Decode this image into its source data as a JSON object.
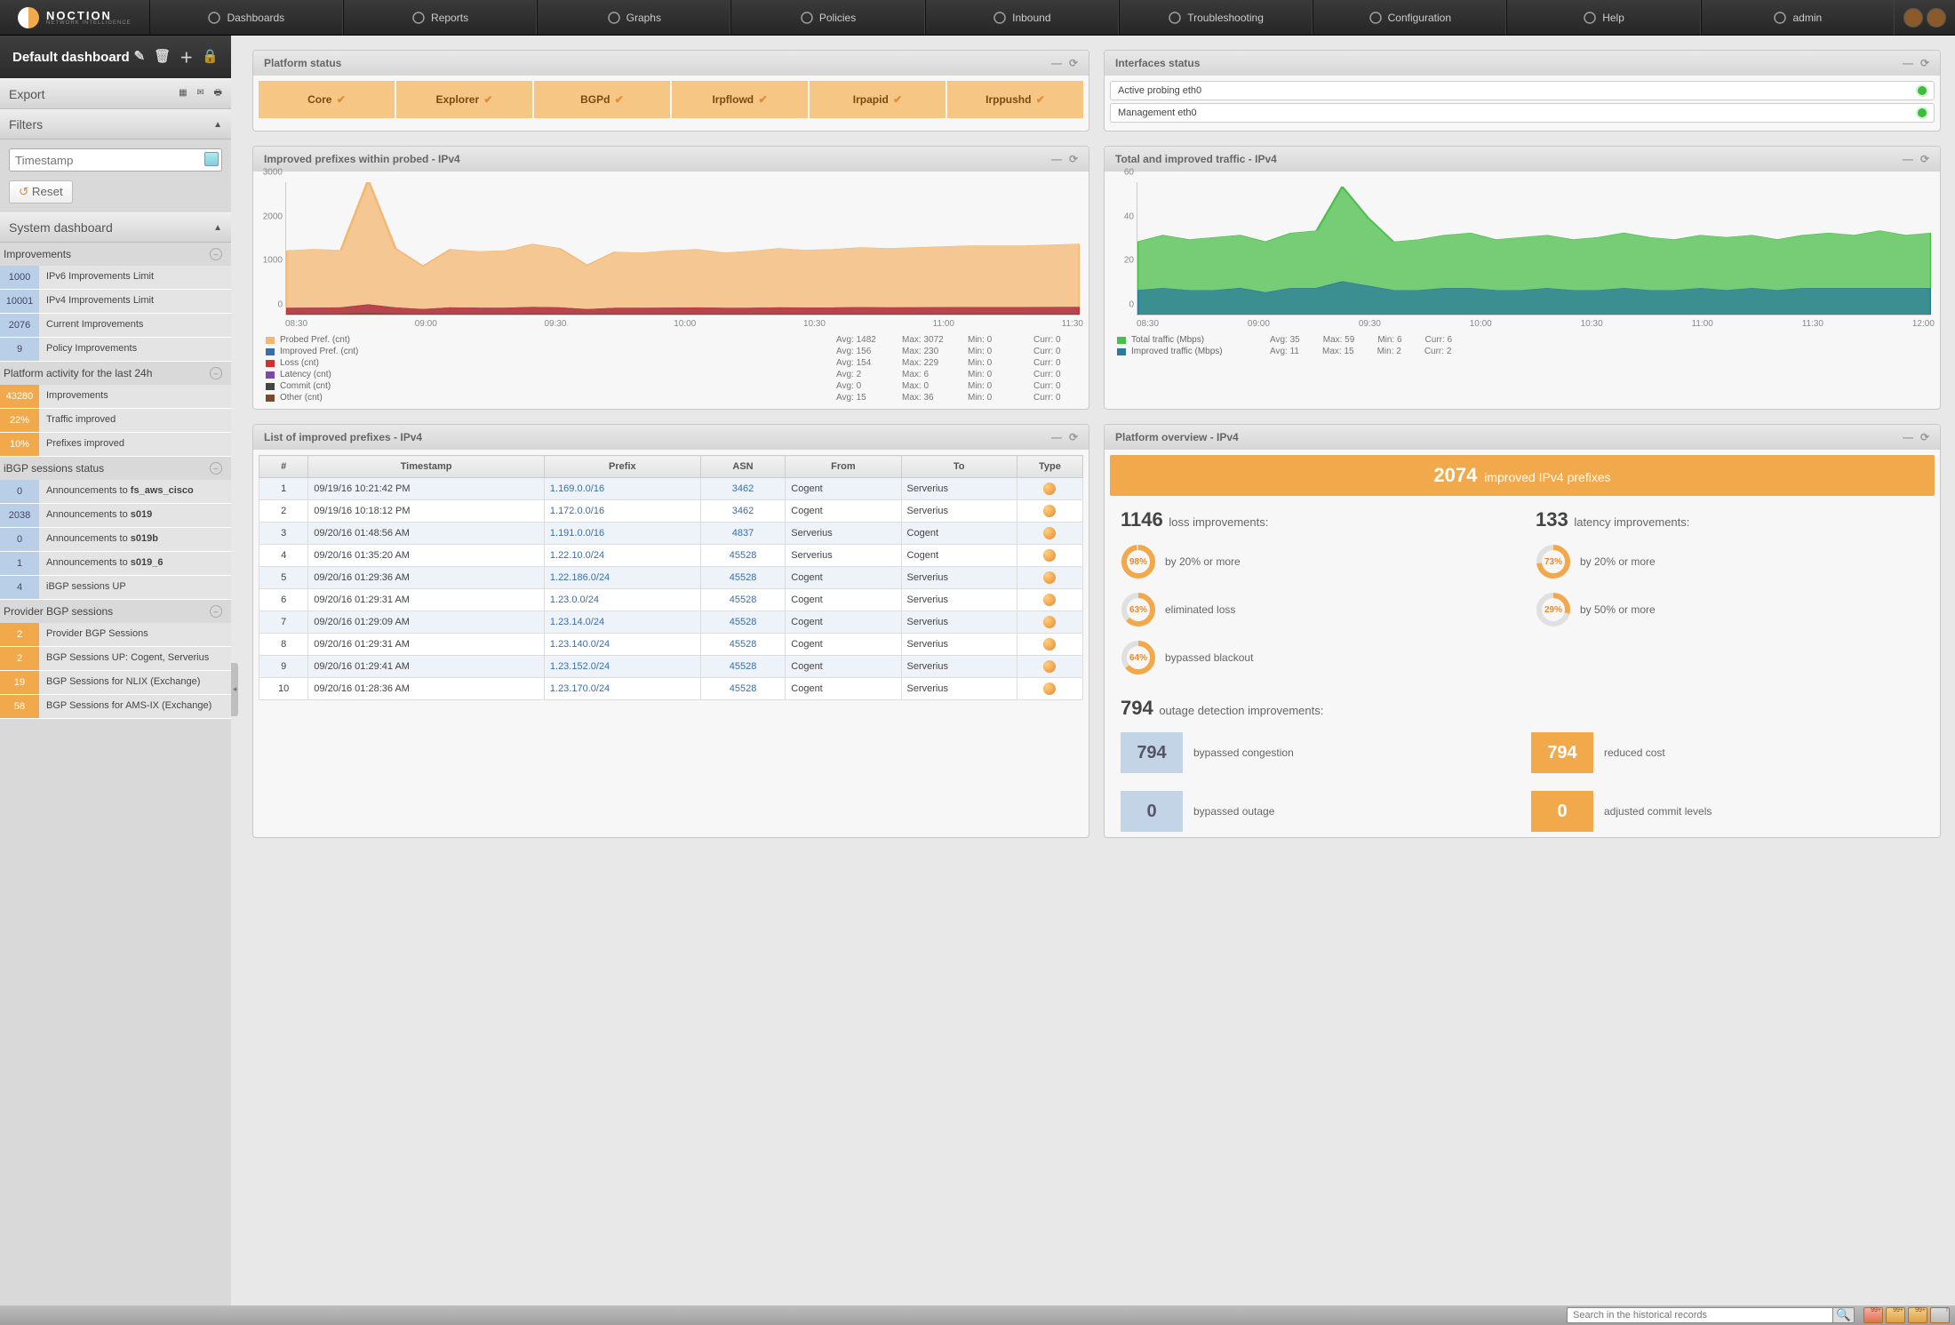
{
  "brand": {
    "name": "NOCTION",
    "sub": "NETWORK INTELLIGENCE"
  },
  "nav": [
    {
      "label": "Dashboards",
      "icon": "gauge"
    },
    {
      "label": "Reports",
      "icon": "doc"
    },
    {
      "label": "Graphs",
      "icon": "pie"
    },
    {
      "label": "Policies",
      "icon": "globe"
    },
    {
      "label": "Inbound",
      "icon": "globe"
    },
    {
      "label": "Troubleshooting",
      "icon": "search"
    },
    {
      "label": "Configuration",
      "icon": "gear"
    },
    {
      "label": "Help",
      "icon": "life"
    },
    {
      "label": "admin",
      "icon": "user"
    }
  ],
  "sidebar": {
    "title": "Default dashboard",
    "export": "Export",
    "filters": "Filters",
    "timestamp_ph": "Timestamp",
    "reset": "Reset",
    "system": "System dashboard",
    "groups": [
      {
        "title": "Improvements",
        "rows": [
          {
            "v": "1000",
            "c": "blue",
            "t": "IPv6 Improvements Limit"
          },
          {
            "v": "10001",
            "c": "blue",
            "t": "IPv4 Improvements Limit"
          },
          {
            "v": "2076",
            "c": "blue",
            "t": "Current Improvements"
          },
          {
            "v": "9",
            "c": "blue",
            "t": "Policy Improvements"
          }
        ]
      },
      {
        "title": "Platform activity for the last 24h",
        "rows": [
          {
            "v": "43280",
            "c": "orange",
            "t": "Improvements"
          },
          {
            "v": "22%",
            "c": "orange",
            "t": "Traffic improved"
          },
          {
            "v": "10%",
            "c": "orange",
            "t": "Prefixes improved"
          }
        ]
      },
      {
        "title": "iBGP sessions status",
        "rows": [
          {
            "v": "0",
            "c": "blue",
            "t": "Announcements to <b>fs_aws_cisco</b>"
          },
          {
            "v": "2038",
            "c": "blue",
            "t": "Announcements to <b>s019</b>"
          },
          {
            "v": "0",
            "c": "blue",
            "t": "Announcements to <b>s019b</b>"
          },
          {
            "v": "1",
            "c": "blue",
            "t": "Announcements to <b>s019_6</b>"
          },
          {
            "v": "4",
            "c": "blue",
            "t": "iBGP sessions UP"
          }
        ]
      },
      {
        "title": "Provider BGP sessions",
        "rows": [
          {
            "v": "2",
            "c": "orange",
            "t": "Provider BGP Sessions"
          },
          {
            "v": "2",
            "c": "orange",
            "t": "BGP Sessions UP: Cogent, Serverius"
          },
          {
            "v": "19",
            "c": "orange",
            "t": "BGP Sessions for NLIX (Exchange)"
          },
          {
            "v": "58",
            "c": "orange",
            "t": "BGP Sessions for AMS-IX (Exchange)"
          }
        ]
      }
    ]
  },
  "platform_status": {
    "title": "Platform status",
    "cells": [
      "Core",
      "Explorer",
      "BGPd",
      "Irpflowd",
      "Irpapid",
      "Irppushd"
    ]
  },
  "interfaces": {
    "title": "Interfaces status",
    "rows": [
      "Active probing eth0",
      "Management eth0"
    ]
  },
  "chart_data": [
    {
      "panel": "Improved prefixes within probed - IPv4",
      "type": "area",
      "x": [
        "08:30",
        "09:00",
        "09:30",
        "10:00",
        "10:30",
        "11:00",
        "11:30"
      ],
      "ylim": [
        0,
        3000
      ],
      "yticks": [
        0,
        1000,
        2000,
        3000
      ],
      "series": [
        {
          "name": "Probed Pref. (cnt)",
          "color": "#f3b771",
          "values": [
            1450,
            1480,
            1460,
            3050,
            1500,
            1100,
            1480,
            1430,
            1450,
            1600,
            1500,
            1120,
            1420,
            1400,
            1450,
            1480,
            1400,
            1440,
            1500,
            1460,
            1480,
            1520,
            1500,
            1520,
            1540,
            1560,
            1560,
            1560,
            1580,
            1600
          ],
          "stats": {
            "avg": 1482,
            "max": 3072,
            "min": 0,
            "curr": 0
          }
        },
        {
          "name": "Improved Pref. (cnt)",
          "color": "#3a6ea8",
          "values": [
            150,
            155,
            160,
            228,
            158,
            120,
            160,
            154,
            152,
            170,
            160,
            118,
            150,
            148,
            154,
            158,
            150,
            152,
            160,
            156,
            158,
            164,
            160,
            162,
            164,
            166,
            166,
            166,
            168,
            170
          ],
          "stats": {
            "avg": 156,
            "max": 230,
            "min": 0,
            "curr": 0
          }
        },
        {
          "name": "Loss (cnt)",
          "color": "#d03030",
          "values": [
            150,
            152,
            154,
            226,
            156,
            122,
            158,
            152,
            150,
            168,
            158,
            118,
            150,
            148,
            152,
            156,
            150,
            150,
            158,
            154,
            156,
            162,
            158,
            160,
            162,
            164,
            164,
            164,
            166,
            168
          ],
          "stats": {
            "avg": 154,
            "max": 229,
            "min": 0,
            "curr": 0
          }
        },
        {
          "name": "Latency (cnt)",
          "color": "#7a4aa8",
          "values": [
            2,
            2,
            2,
            6,
            2,
            1,
            2,
            2,
            2,
            3,
            2,
            1,
            2,
            2,
            2,
            2,
            2,
            2,
            2,
            2,
            2,
            2,
            2,
            2,
            2,
            2,
            2,
            2,
            2,
            2
          ],
          "stats": {
            "avg": 2,
            "max": 6,
            "min": 0,
            "curr": 0
          }
        },
        {
          "name": "Commit (cnt)",
          "color": "#444",
          "values": [
            0,
            0,
            0,
            0,
            0,
            0,
            0,
            0,
            0,
            0,
            0,
            0,
            0,
            0,
            0,
            0,
            0,
            0,
            0,
            0,
            0,
            0,
            0,
            0,
            0,
            0,
            0,
            0,
            0,
            0
          ],
          "stats": {
            "avg": 0,
            "max": 0,
            "min": 0,
            "curr": 0
          }
        },
        {
          "name": "Other (cnt)",
          "color": "#7a4a2a",
          "values": [
            15,
            15,
            15,
            36,
            15,
            12,
            15,
            15,
            15,
            17,
            15,
            12,
            15,
            15,
            15,
            15,
            15,
            15,
            15,
            15,
            15,
            16,
            15,
            15,
            15,
            16,
            16,
            16,
            16,
            16
          ],
          "stats": {
            "avg": 15,
            "max": 36,
            "min": 0,
            "curr": 0
          }
        }
      ]
    },
    {
      "panel": "Total and improved traffic - IPv4",
      "type": "area",
      "x": [
        "08:30",
        "09:00",
        "09:30",
        "10:00",
        "10:30",
        "11:00",
        "11:30",
        "12:00"
      ],
      "ylim": [
        0,
        60
      ],
      "yticks": [
        0,
        20,
        40,
        60
      ],
      "series": [
        {
          "name": "Total traffic (Mbps)",
          "color": "#4bbf4b",
          "values": [
            33,
            36,
            34,
            35,
            36,
            33,
            37,
            38,
            58,
            44,
            33,
            34,
            36,
            37,
            34,
            35,
            36,
            34,
            35,
            37,
            35,
            34,
            36,
            35,
            36,
            34,
            36,
            37,
            36,
            38,
            36,
            37
          ],
          "stats": {
            "avg": 35,
            "max": 59,
            "min": 6,
            "curr": 6
          }
        },
        {
          "name": "Improved traffic (Mbps)",
          "color": "#2a7a9a",
          "values": [
            11,
            12,
            11,
            11,
            12,
            10,
            12,
            12,
            15,
            13,
            11,
            11,
            12,
            12,
            11,
            11,
            12,
            11,
            11,
            12,
            11,
            11,
            12,
            11,
            12,
            11,
            12,
            12,
            12,
            12,
            12,
            12
          ],
          "stats": {
            "avg": 11,
            "max": 15,
            "min": 2,
            "curr": 2
          }
        }
      ]
    }
  ],
  "prefix_table": {
    "title": "List of improved prefixes - IPv4",
    "cols": [
      "#",
      "Timestamp",
      "Prefix",
      "ASN",
      "From",
      "To",
      "Type"
    ],
    "rows": [
      [
        "1",
        "09/19/16 10:21:42 PM",
        "1.169.0.0/16",
        "3462",
        "Cogent",
        "Serverius"
      ],
      [
        "2",
        "09/19/16 10:18:12 PM",
        "1.172.0.0/16",
        "3462",
        "Cogent",
        "Serverius"
      ],
      [
        "3",
        "09/20/16 01:48:56 AM",
        "1.191.0.0/16",
        "4837",
        "Serverius",
        "Cogent"
      ],
      [
        "4",
        "09/20/16 01:35:20 AM",
        "1.22.10.0/24",
        "45528",
        "Serverius",
        "Cogent"
      ],
      [
        "5",
        "09/20/16 01:29:36 AM",
        "1.22.186.0/24",
        "45528",
        "Cogent",
        "Serverius"
      ],
      [
        "6",
        "09/20/16 01:29:31 AM",
        "1.23.0.0/24",
        "45528",
        "Cogent",
        "Serverius"
      ],
      [
        "7",
        "09/20/16 01:29:09 AM",
        "1.23.14.0/24",
        "45528",
        "Cogent",
        "Serverius"
      ],
      [
        "8",
        "09/20/16 01:29:31 AM",
        "1.23.140.0/24",
        "45528",
        "Cogent",
        "Serverius"
      ],
      [
        "9",
        "09/20/16 01:29:41 AM",
        "1.23.152.0/24",
        "45528",
        "Cogent",
        "Serverius"
      ],
      [
        "10",
        "09/20/16 01:28:36 AM",
        "1.23.170.0/24",
        "45528",
        "Cogent",
        "Serverius"
      ]
    ]
  },
  "overview": {
    "title": "Platform overview - IPv4",
    "banner_n": "2074",
    "banner_t": "improved IPv4 prefixes",
    "loss_n": "1146",
    "loss_t": "loss improvements:",
    "lat_n": "133",
    "lat_t": "latency improvements:",
    "loss_metrics": [
      {
        "p": 98,
        "t": "by 20% or more"
      },
      {
        "p": 63,
        "t": "eliminated loss"
      },
      {
        "p": 64,
        "t": "bypassed blackout"
      }
    ],
    "lat_metrics": [
      {
        "p": 73,
        "t": "by 20% or more"
      },
      {
        "p": 29,
        "t": "by 50% or more"
      }
    ],
    "out_n": "794",
    "out_t": "outage detection improvements:",
    "boxes": [
      {
        "n": "794",
        "c": "blue",
        "t": "bypassed congestion"
      },
      {
        "n": "794",
        "c": "orange",
        "t": "reduced cost"
      },
      {
        "n": "0",
        "c": "blue",
        "t": "bypassed outage"
      },
      {
        "n": "0",
        "c": "orange",
        "t": "adjusted commit levels"
      }
    ]
  },
  "footer": {
    "search_ph": "Search in the historical records",
    "badges": [
      "99+",
      "99+",
      "99+",
      "!"
    ]
  }
}
